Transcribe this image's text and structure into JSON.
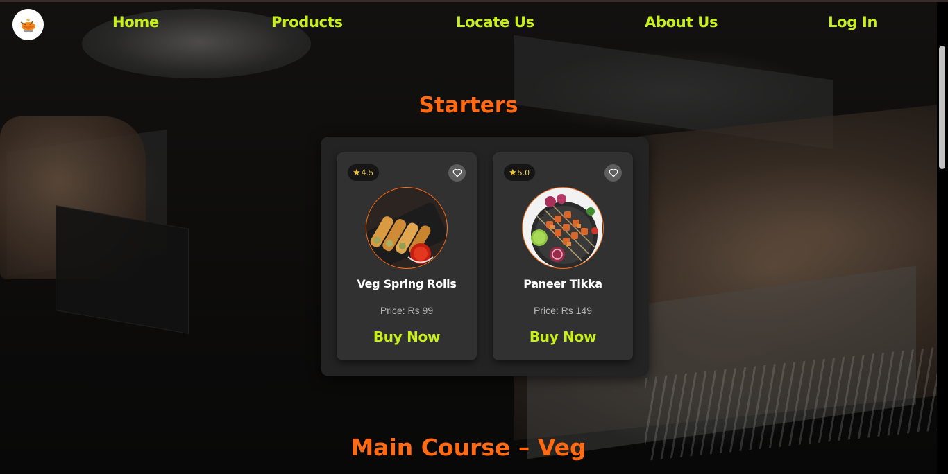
{
  "nav": {
    "logo_icon": "restaurant-logo-icon",
    "links": [
      "Home",
      "Products",
      "Locate Us",
      "About Us",
      "Log In"
    ]
  },
  "sections": [
    {
      "title": "Starters",
      "items": [
        {
          "rating": "4.5",
          "name": "Veg Spring Rolls",
          "price": "Price: Rs 99",
          "cta": "Buy Now",
          "image_icon": "spring-rolls-image"
        },
        {
          "rating": "5.0",
          "name": "Paneer Tikka",
          "price": "Price: Rs 149",
          "cta": "Buy Now",
          "image_icon": "paneer-tikka-image"
        }
      ]
    },
    {
      "title": "Main Course – Veg"
    }
  ],
  "colors": {
    "accent_orange": "#ff6a13",
    "accent_lime": "#c7f01a",
    "card_bg": "#313131",
    "panel_bg": "#232323"
  }
}
